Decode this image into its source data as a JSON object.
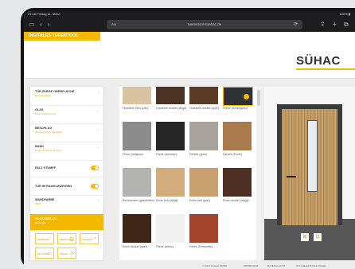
{
  "statusbar": {
    "time": "07:16 Freitag 11. März",
    "right": "100% ▮"
  },
  "browser": {
    "aa": "AA",
    "url": "tuerentool-suehac.de",
    "reload": "⟳"
  },
  "brand": {
    "tag": "DIGITALES TÜRENTOOL",
    "logo": "SÜHAC"
  },
  "options": [
    {
      "label": "TÜR ZARGE OBERFLÄCHE",
      "sub": "Eiche Endgrain",
      "type": "chevron"
    },
    {
      "label": "GLAS",
      "sub": "Glas Lichtausschnitt",
      "type": "chevron"
    },
    {
      "label": "BESCHLAG",
      "sub": "Drückergarnitur Edelstahl",
      "type": "chevron"
    },
    {
      "label": "BAND",
      "sub": "Tectus 3D-Band verdeckt",
      "type": "chevron"
    },
    {
      "label": "FALZ STUMPF",
      "sub": "",
      "type": "toggle"
    },
    {
      "label": "TÜR IM RAUM ANZEIGEN",
      "sub": "",
      "type": "toggle"
    },
    {
      "label": "WANDFARBE",
      "sub": "Weiß",
      "type": "chevron"
    },
    {
      "label": "BODENBELAG",
      "sub": "Eiche hell",
      "type": "active"
    }
  ],
  "buttons": [
    {
      "label": "ANFRAGE",
      "icon": "♡"
    },
    {
      "label": "MERKLISTE",
      "icon": "▢"
    },
    {
      "label": "ANSICHT",
      "icon": "◔"
    },
    {
      "label": "DRUCKEN",
      "icon": "▭"
    },
    {
      "label": "TEILEN",
      "icon": "◇"
    }
  ],
  "floor_options": [
    {
      "label": "Holzdiele hell (quer)",
      "color": "#d9c4a2"
    },
    {
      "label": "Holzdiele dunkel (längs)",
      "color": "#4a3324"
    },
    {
      "label": "Holzdiele dunkel (quer)",
      "color": "#5a3b25"
    },
    {
      "label": "Fliese (dunkelgrau)",
      "color": "#303133"
    },
    {
      "label": "Fliese (hellgrau)",
      "color": "#8c8c8c"
    },
    {
      "label": "Fliese (schwarz)",
      "color": "#262626"
    },
    {
      "label": "Parkett (grau)",
      "color": "#a7a39b"
    },
    {
      "label": "Parkett (Eiche)",
      "color": "#a97a4d"
    },
    {
      "label": "Betonboden (geschliffen)",
      "color": "#b3b3b1"
    },
    {
      "label": "Eiche hell (längs)",
      "color": "#d2ac7c"
    },
    {
      "label": "Eiche hell (quer)",
      "color": "#c9a06f"
    },
    {
      "label": "Eiche dunkel (längs)",
      "color": "#4d3021"
    },
    {
      "label": "Eiche dunkel (quer)",
      "color": "#3e2618"
    },
    {
      "label": "Fliese (weiss)",
      "color": "#f1f1f1"
    },
    {
      "label": "Fliese (Terracotta)",
      "color": "#a3452c"
    }
  ],
  "preview": {
    "btn1": "⊞",
    "btn2": "⊡"
  },
  "footer": {
    "copyright": "© 2024 SÜHAC GMBH",
    "impressum": "IMPRESSUM",
    "datenschutz": "DATENSCHUTZ",
    "cookie": "COOKIE-EINSTELLUNGEN"
  }
}
